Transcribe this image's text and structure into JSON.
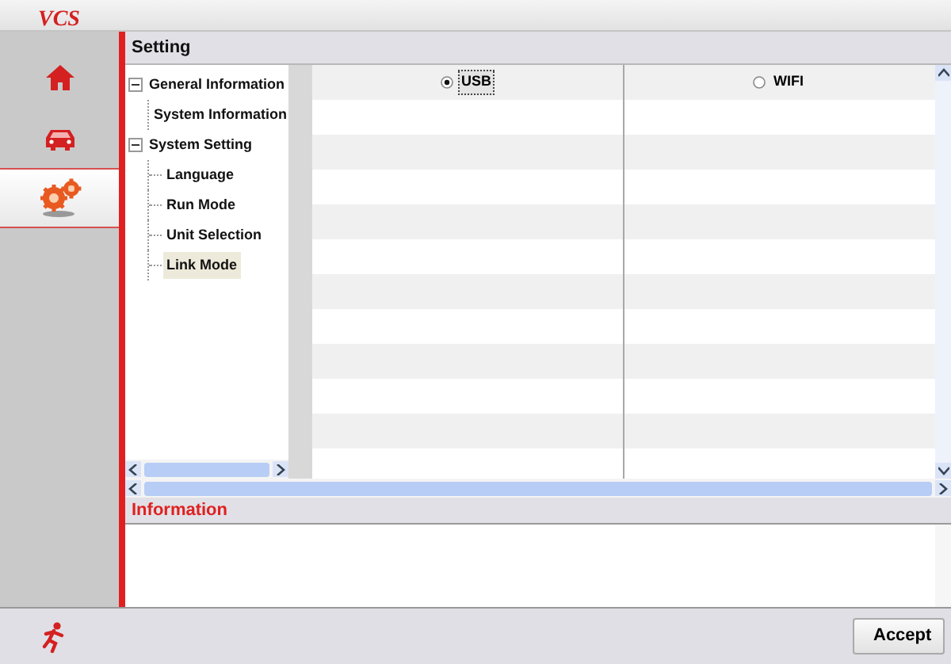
{
  "app": {
    "title": "VCS"
  },
  "sidebar": {
    "items": [
      {
        "kind": "home",
        "selected": false
      },
      {
        "kind": "car",
        "selected": false
      },
      {
        "kind": "gears",
        "selected": true
      }
    ]
  },
  "section": {
    "title": "Setting"
  },
  "tree": [
    {
      "label": "General Information",
      "expanded": true,
      "children": [
        {
          "label": "System Information",
          "selected": false
        }
      ]
    },
    {
      "label": "System Setting",
      "expanded": true,
      "children": [
        {
          "label": "Language",
          "selected": false
        },
        {
          "label": "Run Mode",
          "selected": false
        },
        {
          "label": "Unit Selection",
          "selected": false
        },
        {
          "label": "Link Mode",
          "selected": true
        }
      ]
    }
  ],
  "link_options": [
    {
      "label": "USB",
      "selected": true
    },
    {
      "label": "WIFI",
      "selected": false
    }
  ],
  "information": {
    "title": "Information"
  },
  "footer": {
    "button": "Accept"
  }
}
